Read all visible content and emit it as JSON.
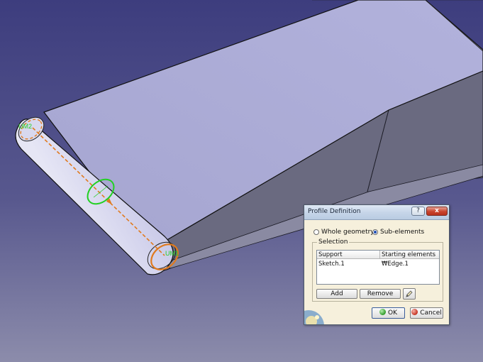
{
  "viewport": {
    "bg_top": "#3d3d7e",
    "bg_bottom": "#8c8cab",
    "part_top_face": "#aaaad2",
    "part_side_face": "#66667c",
    "roller_color": "#b9b9e0",
    "labels": {
      "um2": "UM2",
      "um1": "UM1"
    },
    "highlight_orange": "#e07a1e",
    "highlight_green": "#22d022"
  },
  "dialog": {
    "title": "Profile Definition",
    "help_label": "?",
    "close_label": "x",
    "radio_whole": "Whole geometry",
    "radio_sub": "Sub-elements",
    "selected_radio": "sub-elements",
    "selection_group": "Selection",
    "table": {
      "headers": [
        "Support",
        "Starting elements"
      ],
      "rows": [
        [
          "Sketch.1",
          "₩Edge.1"
        ]
      ]
    },
    "add_label": "Add",
    "remove_label": "Remove",
    "ok_label": "OK",
    "cancel_label": "Cancel"
  }
}
